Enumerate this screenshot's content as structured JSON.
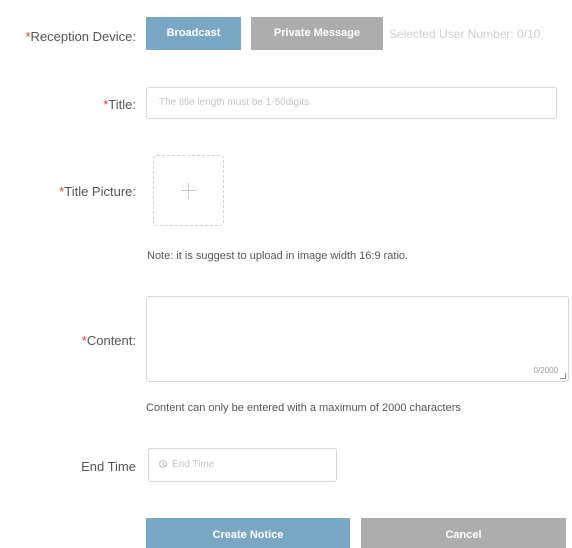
{
  "reception": {
    "required_mark": "*",
    "label": "Reception Device:",
    "broadcast_label": "Broadcast",
    "private_label": "Private Message",
    "selected_count": "Selected User Number: 0/10"
  },
  "title": {
    "required_mark": "*",
    "label": "Title:",
    "placeholder": "The title length must be 1-50digits"
  },
  "title_picture": {
    "required_mark": "*",
    "label": "Title Picture:",
    "note": "Note: it is suggest to upload in image width 16:9 ratio."
  },
  "content": {
    "required_mark": "*",
    "label": "Content:",
    "counter": "0/2000",
    "note": "Content can only be entered with a maximum of 2000 characters"
  },
  "end_time": {
    "label": "End Time",
    "placeholder": "End Time"
  },
  "actions": {
    "create_label": "Create Notice",
    "cancel_label": "Cancel"
  },
  "colors": {
    "primary": "#7aa7c4",
    "secondary": "#adadad",
    "required": "#e4393c"
  }
}
